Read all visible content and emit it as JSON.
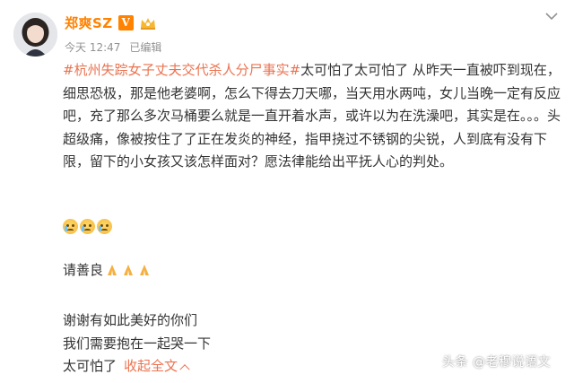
{
  "post": {
    "author": {
      "name": "郑爽SZ",
      "verified_badge": "V",
      "avatar_icon": "avatar-photo"
    },
    "meta": {
      "time": "今天 12:47",
      "edited": "已编辑"
    },
    "body": {
      "topic": "#杭州失踪女子丈夫交代杀人分尸事实#",
      "text": "太可怕了太可怕了 从昨天一直被吓到现在，细思恐极，那是他老婆啊，怎么下得去刀天哪，当天用水两吨，女儿当晚一定有反应吧，充了那么多次马桶要么就是一直开着水声，或许以为在洗澡吧，其实是在。。。头超级痛，像被按住了了正在发炎的神经，指甲挠过不锈钢的尖锐，人到底有没有下限，留下的小女孩又该怎样面对？愿法律能给出平抚人心的判处。"
    },
    "emojis": [
      "crying-face",
      "crying-face",
      "crying-face"
    ],
    "kindness_text": "请善良",
    "pray_icons": [
      "pray-icon",
      "pray-icon",
      "pray-icon"
    ],
    "closing_lines": [
      "谢谢有如此美好的你们",
      "我们需要抱在一起哭一下",
      "太可怕了"
    ],
    "collapse_label": "收起全文",
    "watermark": "头条 @老穆说语文"
  },
  "colors": {
    "username": "#ff8200",
    "topic": "#eb7350",
    "meta": "#939393",
    "text": "#333333"
  }
}
